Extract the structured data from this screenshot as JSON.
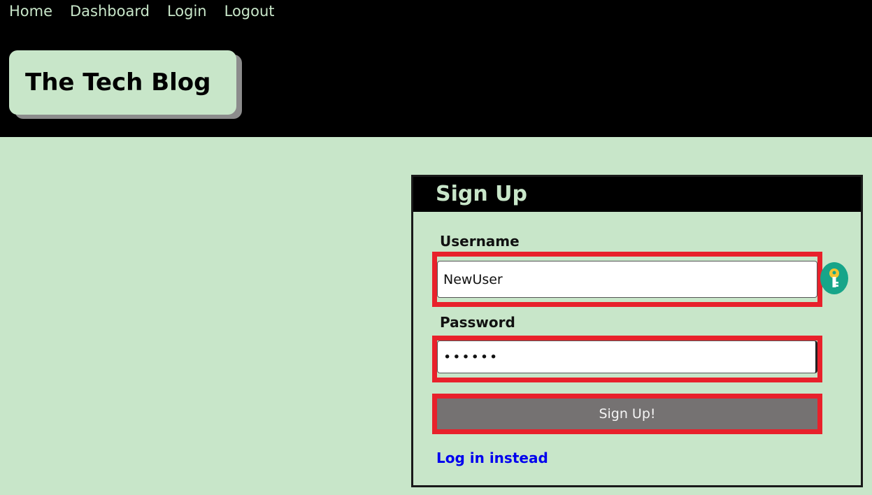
{
  "nav": {
    "items": [
      {
        "label": "Home"
      },
      {
        "label": "Dashboard"
      },
      {
        "label": "Login"
      },
      {
        "label": "Logout"
      }
    ]
  },
  "brand": {
    "title": "The Tech Blog"
  },
  "signup": {
    "title": "Sign Up",
    "username_label": "Username",
    "username_value": "NewUser",
    "password_label": "Password",
    "password_value": "••••••",
    "submit_label": "Sign Up!",
    "login_link": "Log in instead"
  },
  "colors": {
    "background": "#c8e6c9",
    "header": "#000000",
    "highlight": "#e8212b",
    "button": "#757272",
    "link": "#0000ee",
    "key_badge": "#17a589"
  },
  "icons": {
    "password_manager": "key-icon"
  }
}
